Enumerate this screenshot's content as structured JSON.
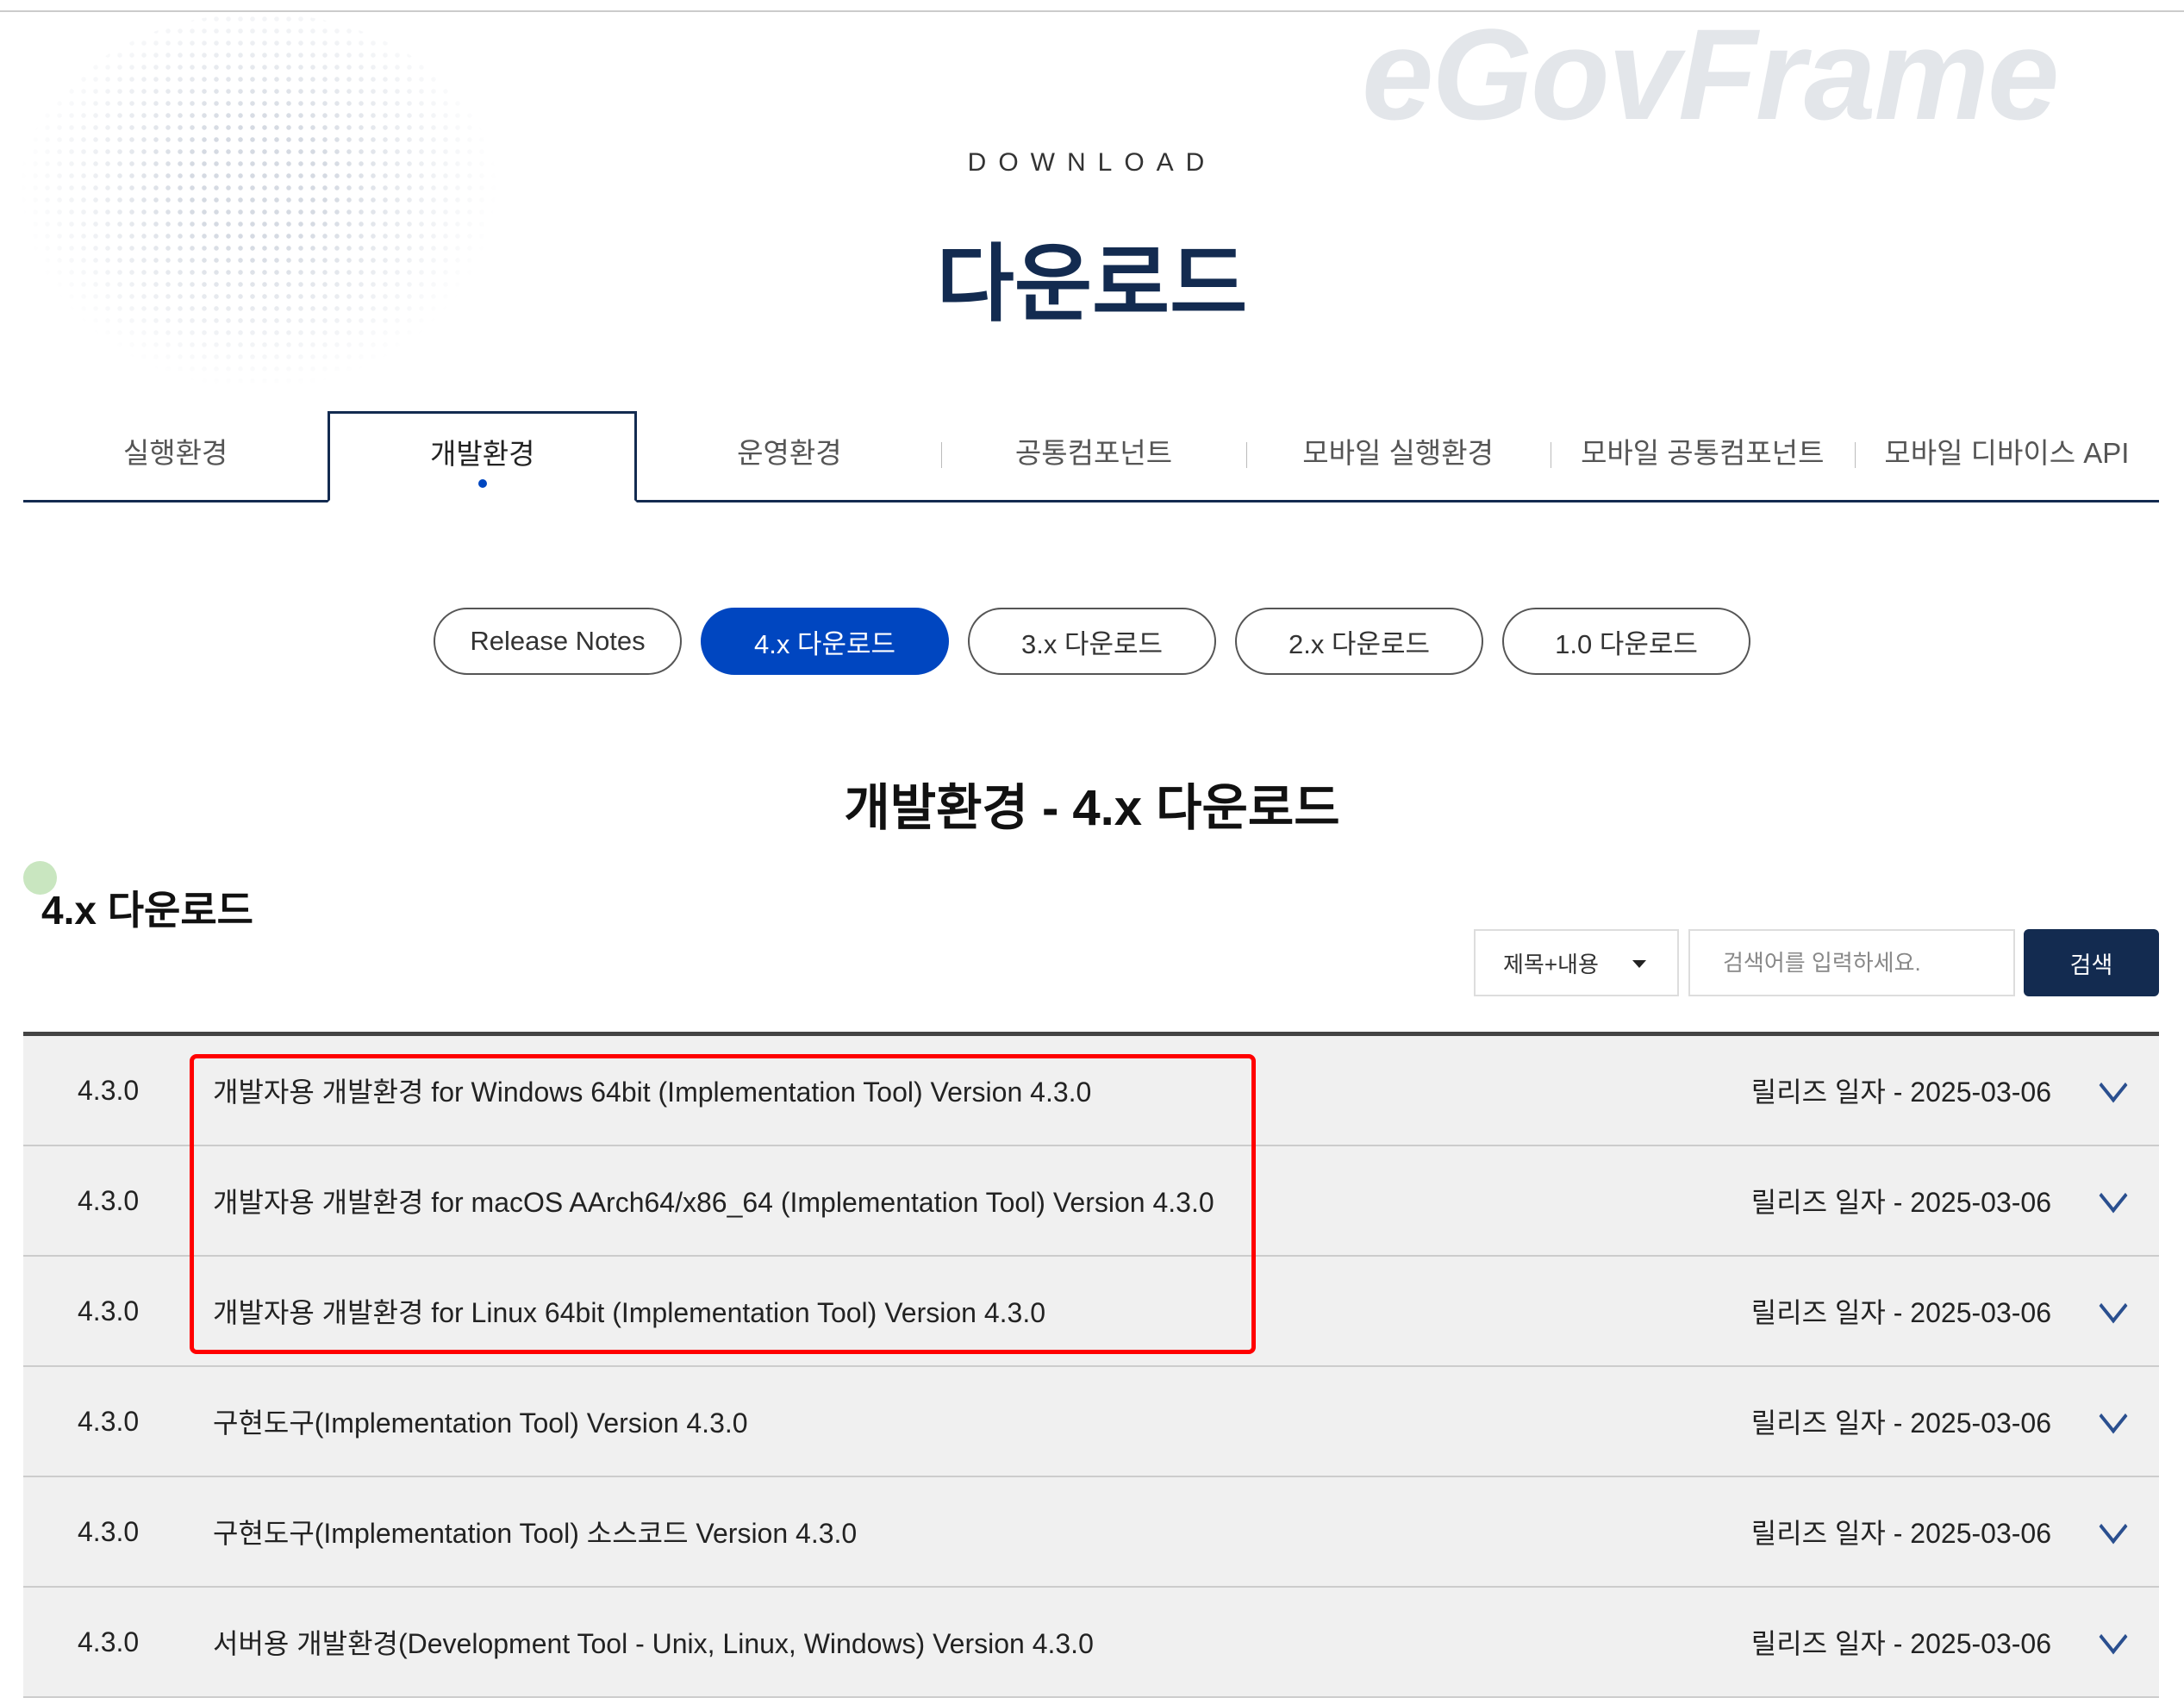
{
  "hero": {
    "watermark": "eGovFrame",
    "eyebrow": "DOWNLOAD",
    "title": "다운로드"
  },
  "tabs": [
    {
      "label": "실행환경",
      "active": false
    },
    {
      "label": "개발환경",
      "active": true
    },
    {
      "label": "운영환경",
      "active": false
    },
    {
      "label": "공통컴포넌트",
      "active": false
    },
    {
      "label": "모바일 실행환경",
      "active": false
    },
    {
      "label": "모바일 공통컴포넌트",
      "active": false
    },
    {
      "label": "모바일 디바이스 API",
      "active": false
    }
  ],
  "pills": [
    {
      "label": "Release Notes",
      "active": false
    },
    {
      "label": "4.x 다운로드",
      "active": true
    },
    {
      "label": "3.x 다운로드",
      "active": false
    },
    {
      "label": "2.x 다운로드",
      "active": false
    },
    {
      "label": "1.0 다운로드",
      "active": false
    }
  ],
  "subheading": "개발환경 - 4.x 다운로드",
  "section_title": "4.x 다운로드",
  "search": {
    "select_value": "제목+내용",
    "placeholder": "검색어를 입력하세요.",
    "button": "검색"
  },
  "rows": [
    {
      "version": "4.3.0",
      "name": "개발자용 개발환경 for Windows 64bit (Implementation Tool) Version 4.3.0",
      "date": "릴리즈 일자 - 2025-03-06"
    },
    {
      "version": "4.3.0",
      "name": "개발자용 개발환경 for macOS AArch64/x86_64 (Implementation Tool) Version 4.3.0",
      "date": "릴리즈 일자 - 2025-03-06"
    },
    {
      "version": "4.3.0",
      "name": "개발자용 개발환경 for Linux 64bit (Implementation Tool) Version 4.3.0",
      "date": "릴리즈 일자 - 2025-03-06"
    },
    {
      "version": "4.3.0",
      "name": "구현도구(Implementation Tool) Version 4.3.0",
      "date": "릴리즈 일자 - 2025-03-06"
    },
    {
      "version": "4.3.0",
      "name": "구현도구(Implementation Tool) 소스코드 Version 4.3.0",
      "date": "릴리즈 일자 - 2025-03-06"
    },
    {
      "version": "4.3.0",
      "name": "서버용 개발환경(Development Tool - Unix, Linux, Windows) Version 4.3.0",
      "date": "릴리즈 일자 - 2025-03-06"
    }
  ],
  "colors": {
    "navy": "#132b50",
    "accent": "#0046c0",
    "highlight": "#ff0000",
    "row_bg": "#f0f0f0"
  }
}
